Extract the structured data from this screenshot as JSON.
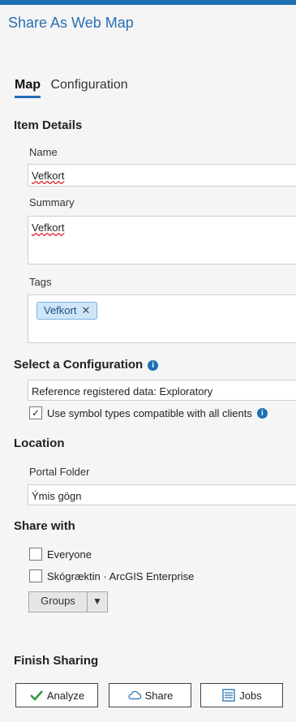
{
  "title": "Share As Web Map",
  "tabs": [
    {
      "label": "Map",
      "active": true
    },
    {
      "label": "Configuration",
      "active": false
    }
  ],
  "item_details": {
    "heading": "Item Details",
    "name_label": "Name",
    "name_value": "Vefkort",
    "summary_label": "Summary",
    "summary_value": "Vefkort",
    "tags_label": "Tags",
    "tags": [
      "Vefkort"
    ],
    "tag_remove_glyph": "✕"
  },
  "configuration": {
    "heading": "Select a Configuration",
    "selected": "Reference registered data: Exploratory",
    "symbol_checkbox_label": "Use symbol types compatible with all clients",
    "symbol_checkbox_checked": true
  },
  "location": {
    "heading": "Location",
    "portal_folder_label": "Portal Folder",
    "portal_folder_value": "Ýmis gögn"
  },
  "share_with": {
    "heading": "Share with",
    "everyone_label": "Everyone",
    "everyone_checked": false,
    "org_label": "Skógræktin · ArcGIS Enterprise",
    "org_checked": false,
    "groups_label": "Groups",
    "groups_dropdown_glyph": "▼"
  },
  "finish": {
    "heading": "Finish Sharing",
    "analyze_label": "Analyze",
    "share_label": "Share",
    "jobs_label": "Jobs"
  },
  "colors": {
    "accent": "#1f6fb5",
    "tag_chip_bg": "#cfe6f8",
    "tag_chip_border": "#7ab2e6",
    "analyze_check": "#2e9a3a"
  }
}
